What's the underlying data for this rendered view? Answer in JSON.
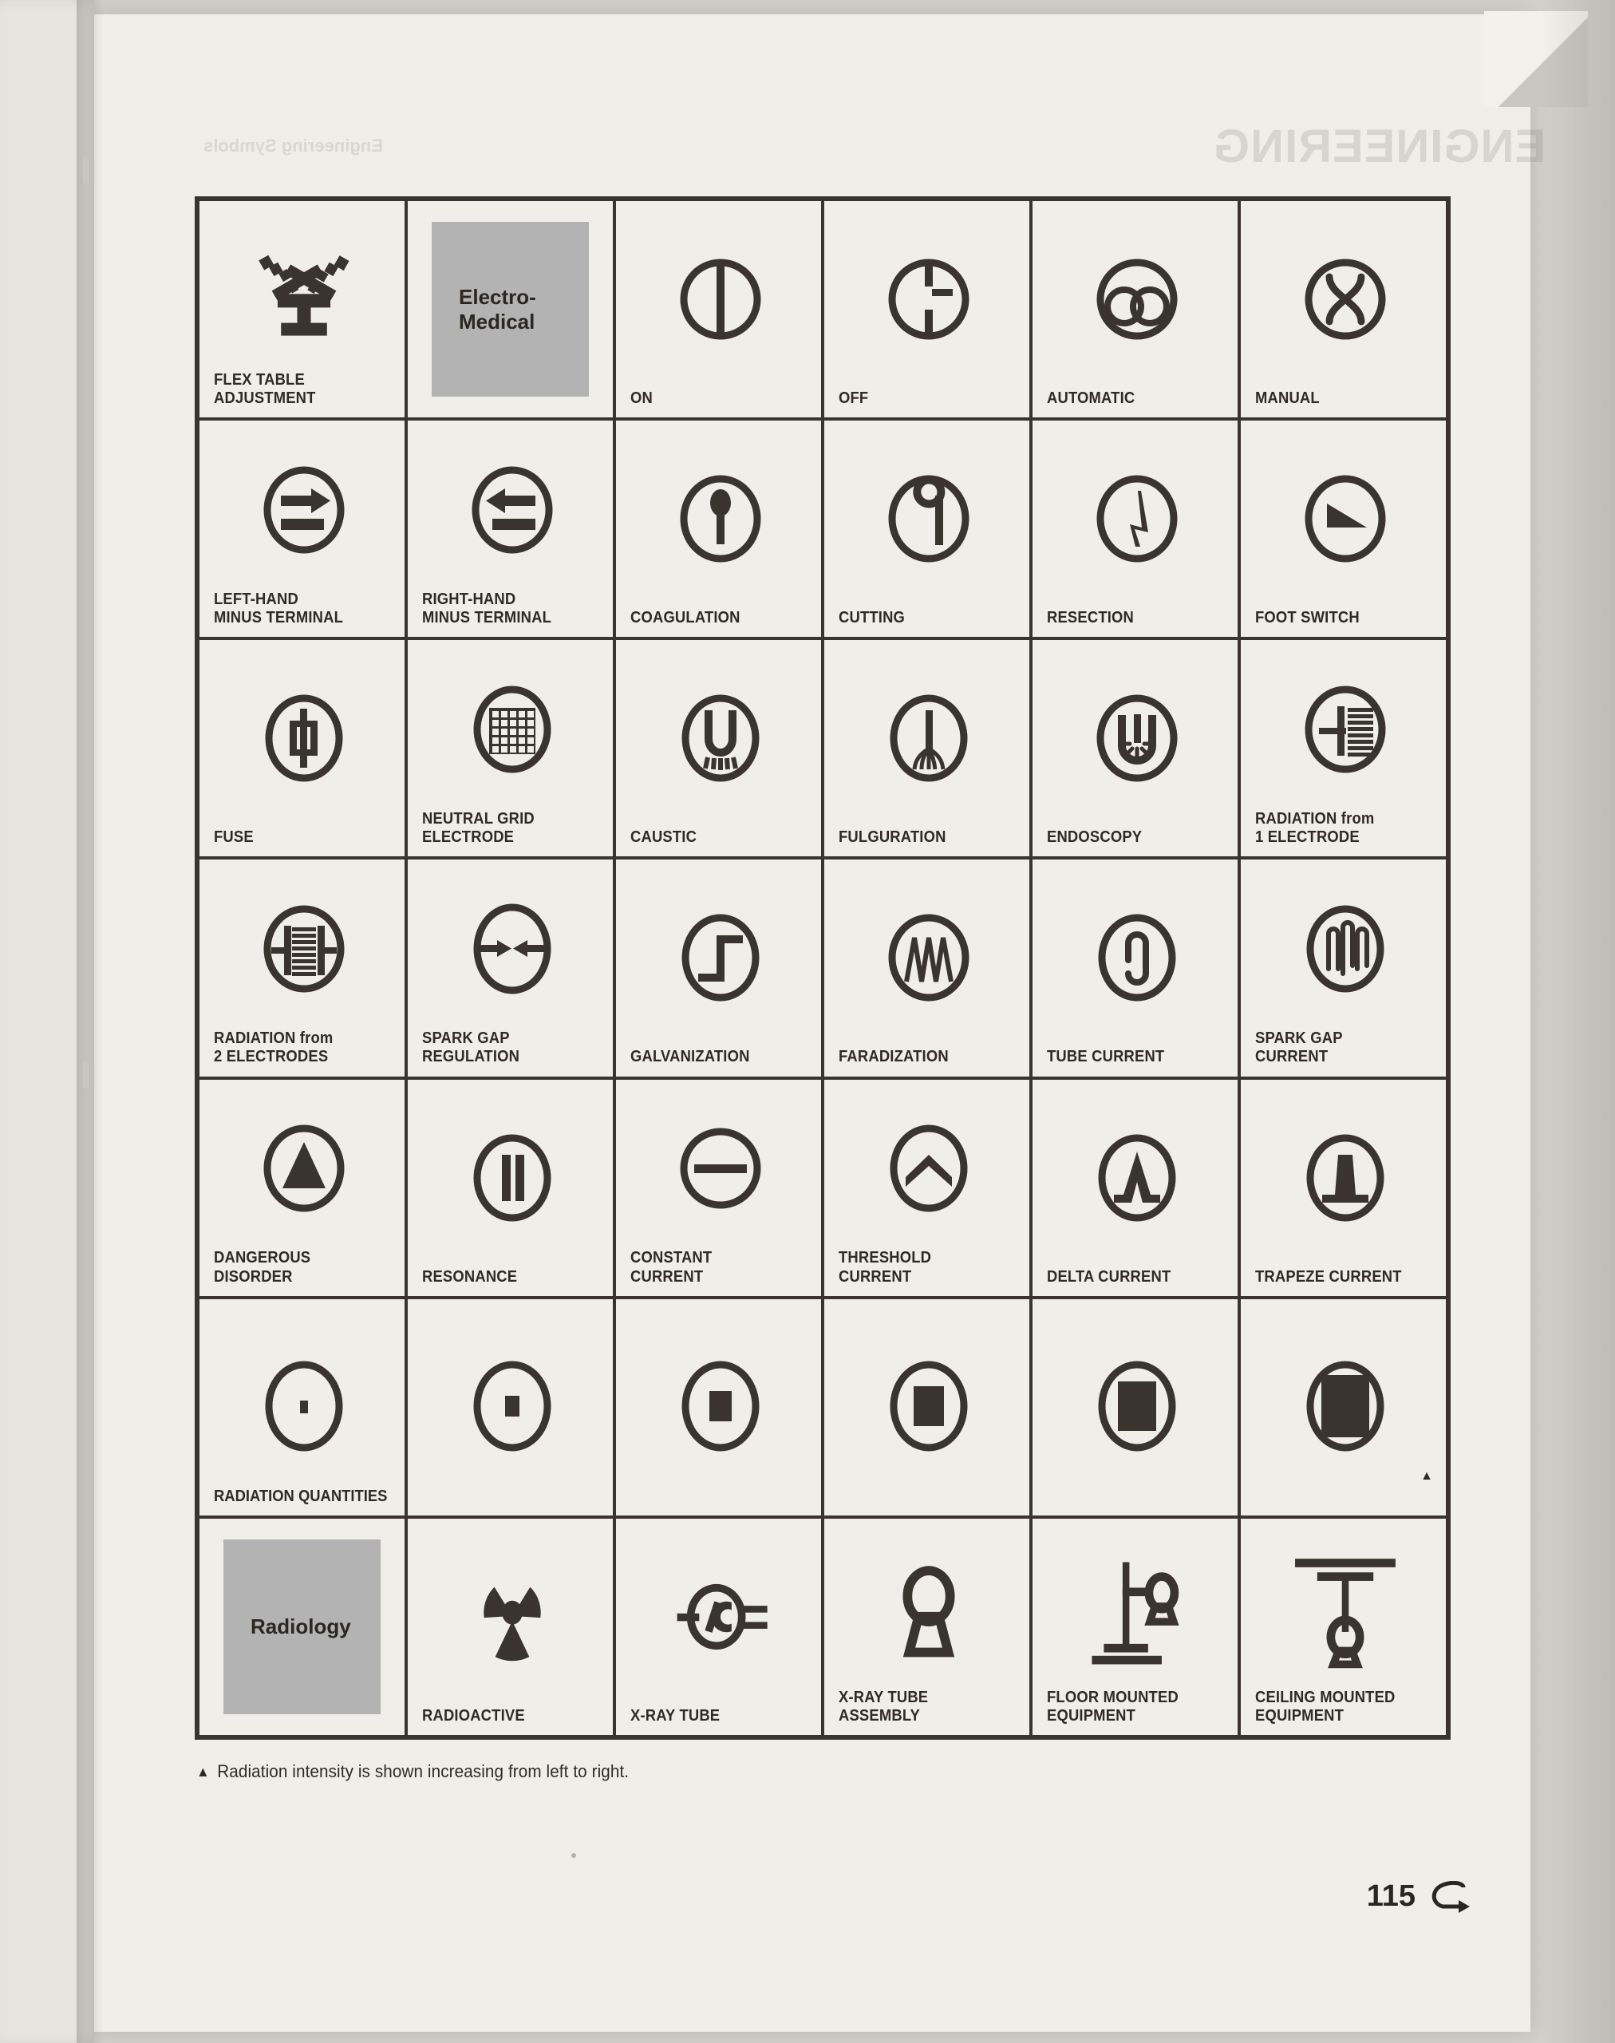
{
  "page": {
    "number": "115",
    "footnote": "Radiation intensity is shown increasing from left to right.",
    "footnote_marker": "▲",
    "ghost_title": "ENGINEERING",
    "ghost_subtitle": "Engineering Symbols",
    "ink_color": "#3a342e",
    "paper_color": "#f0eee9",
    "shade_color": "#b3b3b3"
  },
  "rows": [
    {
      "row_caption": null,
      "cells": [
        {
          "icon": "flex-table-adjustment-icon",
          "label": "FLEX TABLE\nADJUSTMENT",
          "type": "symbol"
        },
        {
          "icon": "section-heading-tile",
          "label": "Electro-\nMedical",
          "type": "section"
        },
        {
          "icon": "on-icon",
          "label": "ON",
          "type": "symbol"
        },
        {
          "icon": "off-icon",
          "label": "OFF",
          "type": "symbol"
        },
        {
          "icon": "automatic-icon",
          "label": "AUTOMATIC",
          "type": "symbol"
        },
        {
          "icon": "manual-icon",
          "label": "MANUAL",
          "type": "symbol"
        }
      ]
    },
    {
      "row_caption": null,
      "cells": [
        {
          "icon": "left-hand-minus-terminal-icon",
          "label": "LEFT-HAND\nMINUS TERMINAL",
          "type": "symbol"
        },
        {
          "icon": "right-hand-minus-terminal-icon",
          "label": "RIGHT-HAND\nMINUS TERMINAL",
          "type": "symbol"
        },
        {
          "icon": "coagulation-icon",
          "label": "COAGULATION",
          "type": "symbol"
        },
        {
          "icon": "cutting-icon",
          "label": "CUTTING",
          "type": "symbol"
        },
        {
          "icon": "resection-icon",
          "label": "RESECTION",
          "type": "symbol"
        },
        {
          "icon": "foot-switch-icon",
          "label": "FOOT SWITCH",
          "type": "symbol"
        }
      ]
    },
    {
      "row_caption": null,
      "cells": [
        {
          "icon": "fuse-icon",
          "label": "FUSE",
          "type": "symbol"
        },
        {
          "icon": "neutral-grid-electrode-icon",
          "label": "NEUTRAL GRID\nELECTRODE",
          "type": "symbol"
        },
        {
          "icon": "caustic-icon",
          "label": "CAUSTIC",
          "type": "symbol"
        },
        {
          "icon": "fulguration-icon",
          "label": "FULGURATION",
          "type": "symbol"
        },
        {
          "icon": "endoscopy-icon",
          "label": "ENDOSCOPY",
          "type": "symbol"
        },
        {
          "icon": "radiation-one-electrode-icon",
          "label": "RADIATION from\n1 ELECTRODE",
          "type": "symbol"
        }
      ]
    },
    {
      "row_caption": null,
      "cells": [
        {
          "icon": "radiation-two-electrodes-icon",
          "label": "RADIATION from\n2 ELECTRODES",
          "type": "symbol"
        },
        {
          "icon": "spark-gap-regulation-icon",
          "label": "SPARK GAP\nREGULATION",
          "type": "symbol"
        },
        {
          "icon": "galvanization-icon",
          "label": "GALVANIZATION",
          "type": "symbol"
        },
        {
          "icon": "faradization-icon",
          "label": "FARADIZATION",
          "type": "symbol"
        },
        {
          "icon": "tube-current-icon",
          "label": "TUBE CURRENT",
          "type": "symbol"
        },
        {
          "icon": "spark-gap-current-icon",
          "label": "SPARK GAP\nCURRENT",
          "type": "symbol"
        }
      ]
    },
    {
      "row_caption": null,
      "cells": [
        {
          "icon": "dangerous-disorder-icon",
          "label": "DANGEROUS\nDISORDER",
          "type": "symbol"
        },
        {
          "icon": "resonance-icon",
          "label": "RESONANCE",
          "type": "symbol"
        },
        {
          "icon": "constant-current-icon",
          "label": "CONSTANT\nCURRENT",
          "type": "symbol"
        },
        {
          "icon": "threshold-current-icon",
          "label": "THRESHOLD\nCURRENT",
          "type": "symbol"
        },
        {
          "icon": "delta-current-icon",
          "label": "DELTA CURRENT",
          "type": "symbol"
        },
        {
          "icon": "trapeze-current-icon",
          "label": "TRAPEZE CURRENT",
          "type": "symbol"
        }
      ]
    },
    {
      "row_caption": "RADIATION QUANTITIES",
      "cells": [
        {
          "icon": "radiation-quantity-1-icon",
          "label": "",
          "type": "symbol"
        },
        {
          "icon": "radiation-quantity-2-icon",
          "label": "",
          "type": "symbol"
        },
        {
          "icon": "radiation-quantity-3-icon",
          "label": "",
          "type": "symbol"
        },
        {
          "icon": "radiation-quantity-4-icon",
          "label": "",
          "type": "symbol"
        },
        {
          "icon": "radiation-quantity-5-icon",
          "label": "",
          "type": "symbol"
        },
        {
          "icon": "radiation-quantity-6-icon",
          "label": "",
          "type": "symbol"
        }
      ]
    },
    {
      "row_caption": null,
      "cells": [
        {
          "icon": "section-heading-tile",
          "label": "Radiology",
          "type": "section"
        },
        {
          "icon": "radioactive-icon",
          "label": "RADIOACTIVE",
          "type": "symbol"
        },
        {
          "icon": "x-ray-tube-icon",
          "label": "X-RAY TUBE",
          "type": "symbol"
        },
        {
          "icon": "x-ray-tube-assembly-icon",
          "label": "X-RAY TUBE\nASSEMBLY",
          "type": "symbol"
        },
        {
          "icon": "floor-mounted-equipment-icon",
          "label": "FLOOR MOUNTED\nEQUIPMENT",
          "type": "symbol"
        },
        {
          "icon": "ceiling-mounted-equipment-icon",
          "label": "CEILING MOUNTED\nEQUIPMENT",
          "type": "symbol"
        }
      ]
    }
  ]
}
